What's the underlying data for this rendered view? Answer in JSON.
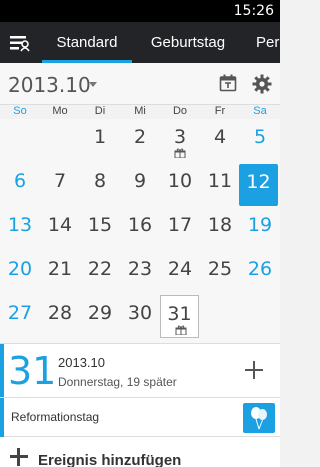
{
  "status_bar": {
    "time": "15:26"
  },
  "tabs": [
    {
      "label": "Standard",
      "active": true
    },
    {
      "label": "Geburtstag",
      "active": false
    },
    {
      "label": "Peri",
      "active": false
    }
  ],
  "header": {
    "month_title": "2013.10"
  },
  "weekdays": [
    "So",
    "Mo",
    "Di",
    "Mi",
    "Do",
    "Fr",
    "Sa"
  ],
  "calendar": {
    "weeks": [
      [
        "",
        "",
        "1",
        "2",
        "3",
        "4",
        "5"
      ],
      [
        "6",
        "7",
        "8",
        "9",
        "10",
        "11",
        "12"
      ],
      [
        "13",
        "14",
        "15",
        "16",
        "17",
        "18",
        "19"
      ],
      [
        "20",
        "21",
        "22",
        "23",
        "24",
        "25",
        "26"
      ],
      [
        "27",
        "28",
        "29",
        "30",
        "31",
        "",
        ""
      ]
    ],
    "today": "12",
    "selected": "31",
    "gift_days": [
      "3",
      "31"
    ]
  },
  "detail": {
    "day": "31",
    "month": "2013.10",
    "subtitle": "Donnerstag, 19 später"
  },
  "event": {
    "title": "Reformationstag",
    "icon": "balloons-icon"
  },
  "add_event": {
    "label": "Ereignis hinzufügen"
  },
  "colors": {
    "accent": "#1ba1e2",
    "tab_bar": "#222428",
    "status_bar": "#000000"
  }
}
